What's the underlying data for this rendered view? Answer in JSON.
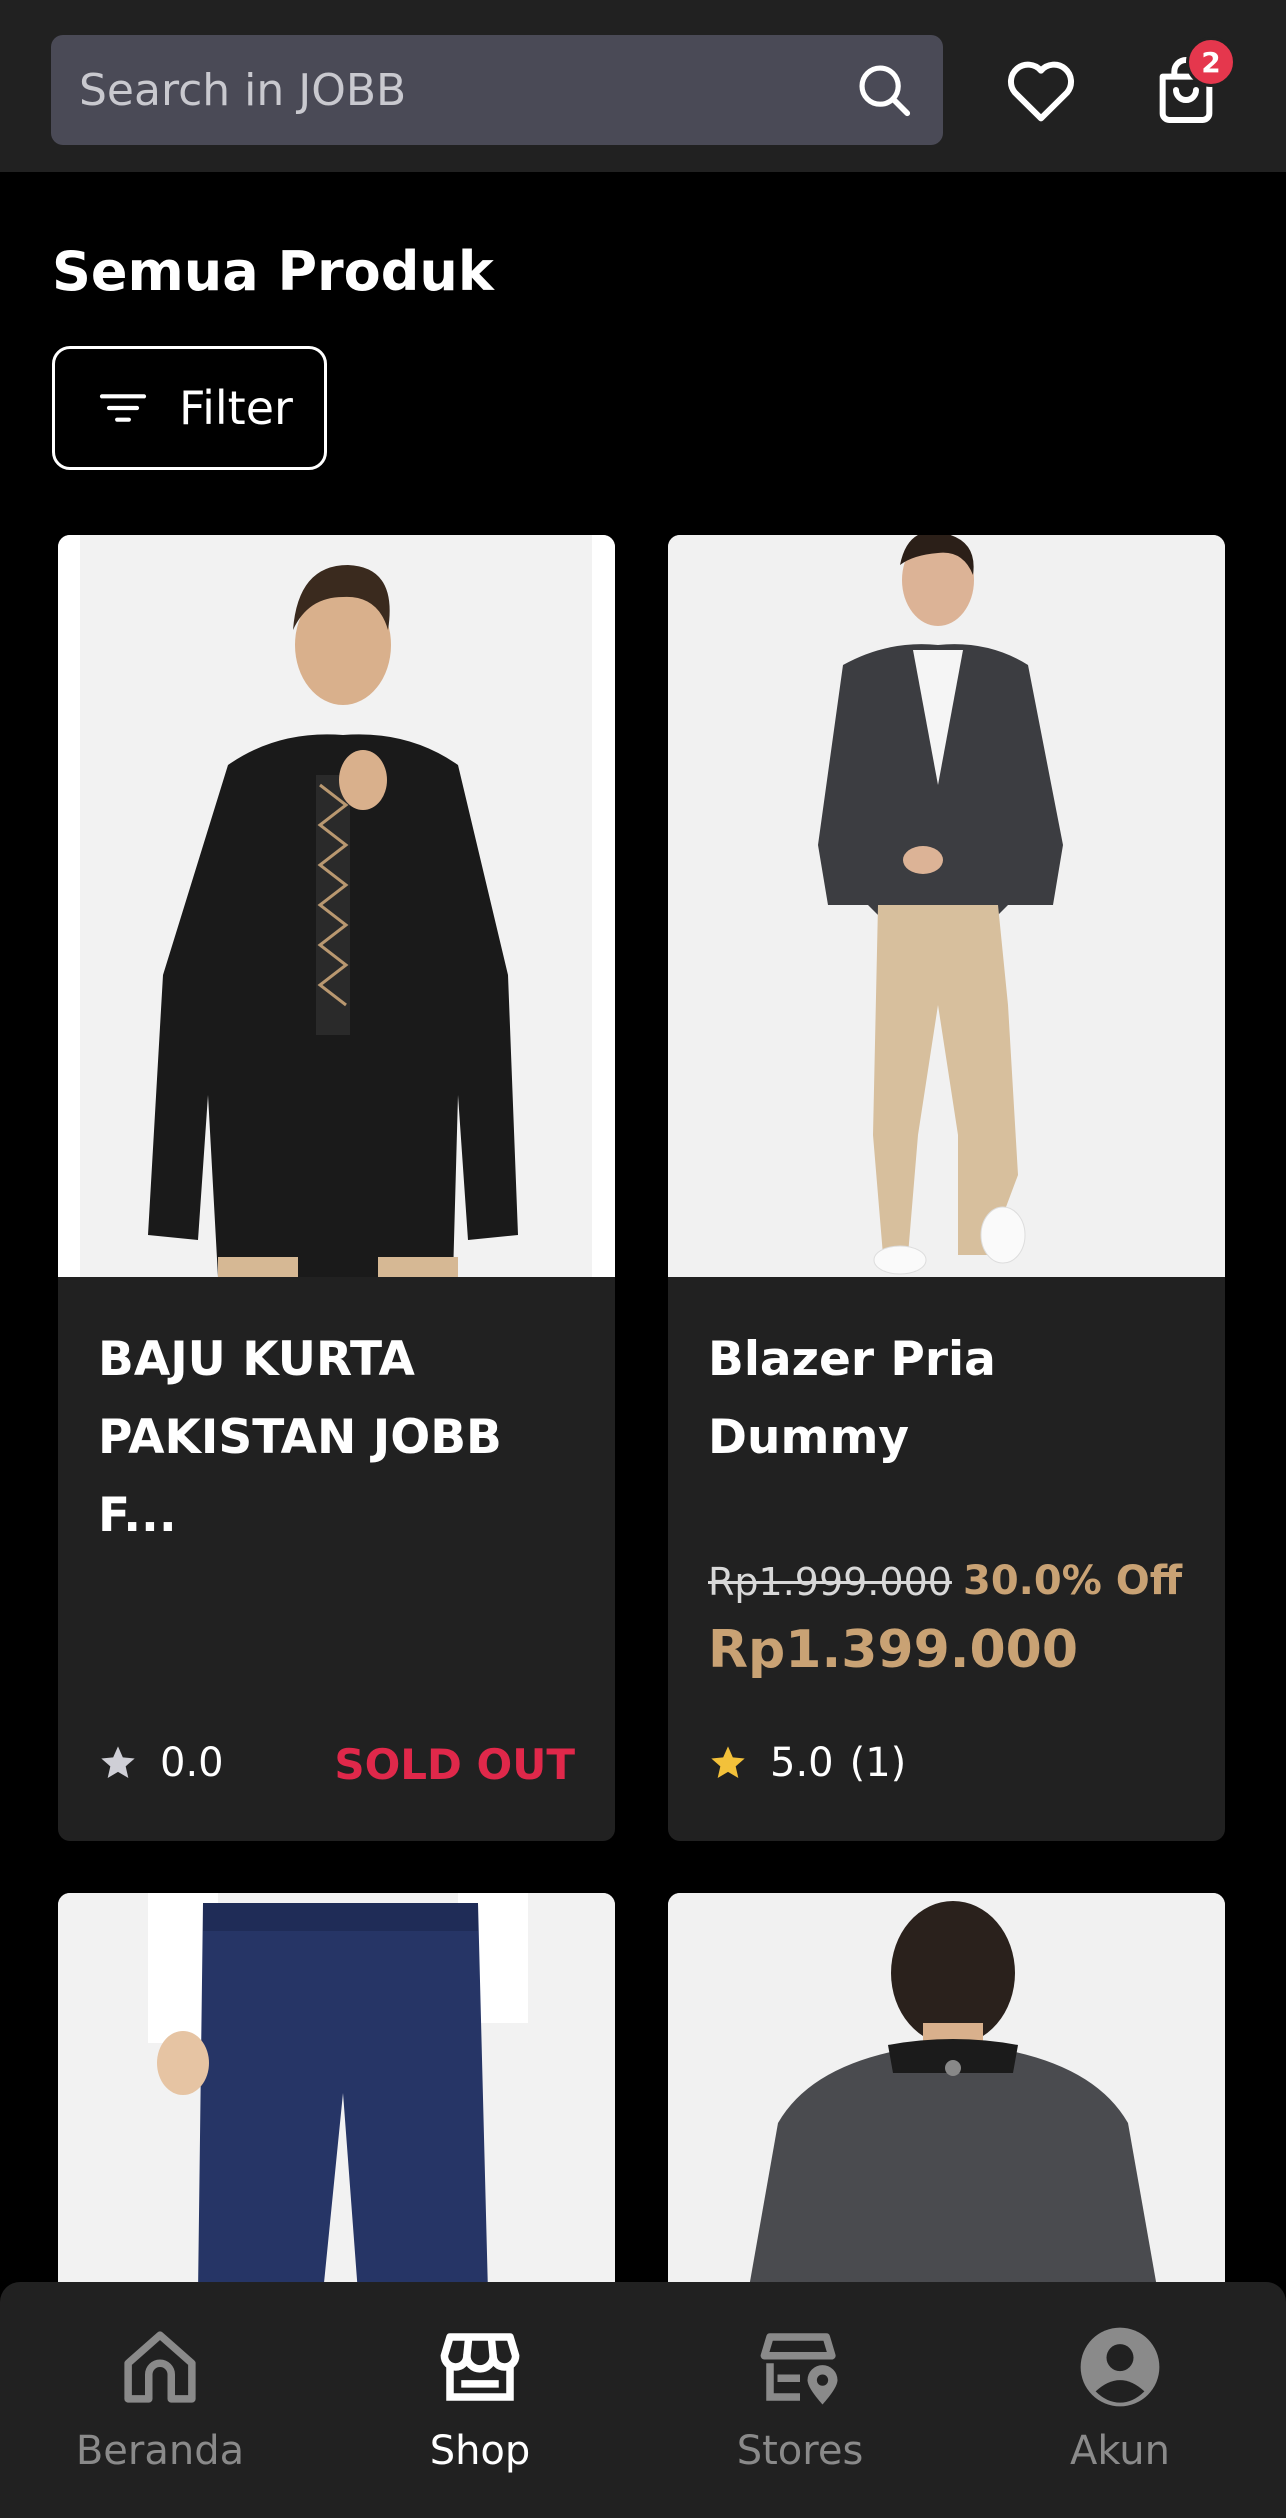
{
  "search": {
    "placeholder": "Search in JOBB"
  },
  "header": {
    "cart_count": "2"
  },
  "page": {
    "title": "Semua Produk",
    "filter_label": "Filter"
  },
  "products": [
    {
      "name": "BAJU KURTA PAKISTAN JOBB F...",
      "rating": "0.0",
      "status": "SOLD OUT"
    },
    {
      "name": "Blazer Pria Dummy",
      "original_price": "Rp1.999.000",
      "discount": "30.0% Off",
      "price": "Rp1.399.000",
      "rating": "5.0",
      "review_count": "(1)"
    },
    {
      "name": "",
      "image": "navy-trousers"
    },
    {
      "name": "",
      "image": "grey-jacket-back"
    }
  ],
  "nav": {
    "items": [
      {
        "label": "Beranda",
        "icon": "home-icon",
        "active": false
      },
      {
        "label": "Shop",
        "icon": "store-icon",
        "active": true
      },
      {
        "label": "Stores",
        "icon": "stores-location-icon",
        "active": false
      },
      {
        "label": "Akun",
        "icon": "account-icon",
        "active": false
      }
    ]
  },
  "colors": {
    "accent_gold": "#c9a274",
    "sold_out_red": "#e0284a",
    "badge_red": "#e5374d",
    "nav_active": "#ffffff",
    "nav_inactive": "#8a8a8a"
  }
}
